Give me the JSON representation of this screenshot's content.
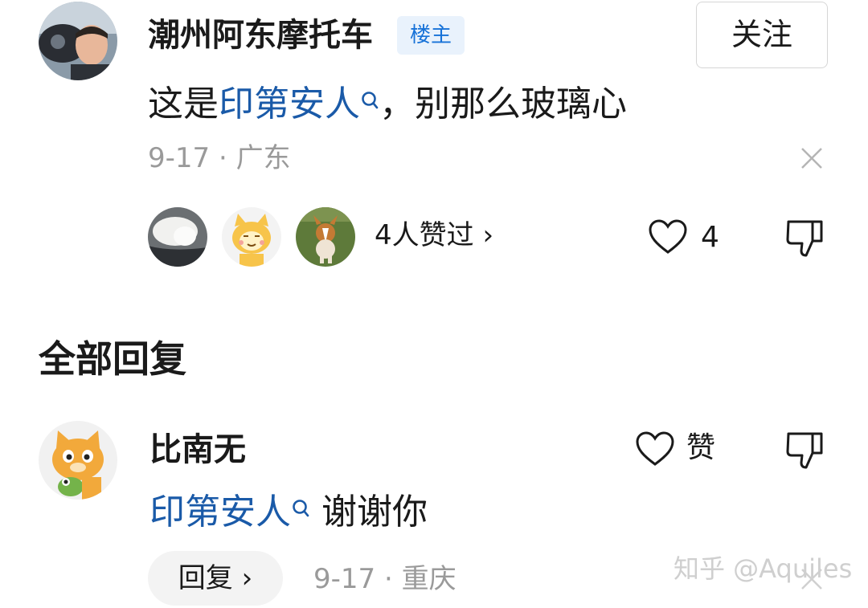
{
  "main_comment": {
    "author": "潮州阿东摩托车",
    "author_badge": "楼主",
    "follow_label": "关注",
    "content_prefix": "这是",
    "content_link": "印第安人",
    "content_suffix": "，别那么玻璃心",
    "date": "9-17",
    "separator": "·",
    "location": "广东",
    "likers_label": "4人赞过",
    "likers_chevron": "›",
    "like_count": "4"
  },
  "section": {
    "title": "全部回复"
  },
  "reply": {
    "author": "比南无",
    "like_label": "赞",
    "content_link": "印第安人",
    "content_suffix": "谢谢你",
    "reply_button_label": "回复",
    "reply_chevron": "›",
    "date": "9-17",
    "separator": "·",
    "location": "重庆"
  },
  "watermark": "知乎 @Aquiles",
  "colors": {
    "link": "#1a5aa8",
    "badge_text": "#1772d8",
    "badge_bg": "#e9f2fc",
    "meta": "#9a9a9a"
  },
  "icons": [
    "search-icon",
    "close-icon",
    "heart-icon",
    "dislike-icon",
    "chevron-right-icon"
  ]
}
